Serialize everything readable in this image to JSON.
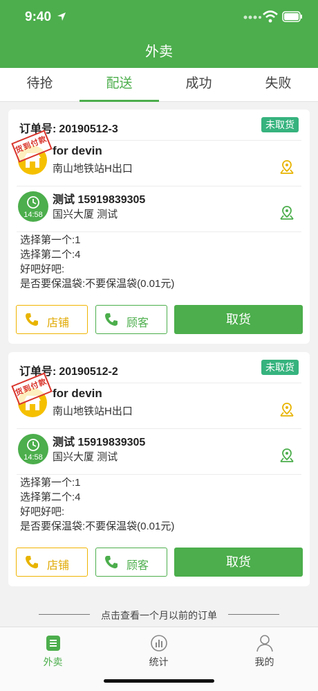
{
  "status_bar": {
    "time": "9:40"
  },
  "header": {
    "title": "外卖"
  },
  "tabs": [
    {
      "label": "待抢",
      "active": false
    },
    {
      "label": "配送",
      "active": true
    },
    {
      "label": "成功",
      "active": false
    },
    {
      "label": "失败",
      "active": false
    }
  ],
  "orders": [
    {
      "order_label": "订单号:",
      "order_no": "20190512-3",
      "status": "未取货",
      "stamp": "货到付款",
      "shop_name": "for devin",
      "shop_address": "南山地铁站H出口",
      "customer_time": "14:58",
      "customer_line": "测试 15919839305",
      "customer_address": "国兴大厦 测试",
      "options": [
        "选择第一个:1",
        "选择第二个:4",
        "好吧好吧:",
        "是否要保温袋:不要保温袋(0.01元)"
      ],
      "btn_store": "店铺",
      "btn_customer": "顾客",
      "btn_pickup": "取货"
    },
    {
      "order_label": "订单号:",
      "order_no": "20190512-2",
      "status": "未取货",
      "stamp": "货到付款",
      "shop_name": "for devin",
      "shop_address": "南山地铁站H出口",
      "customer_time": "14:58",
      "customer_line": "测试 15919839305",
      "customer_address": "国兴大厦 测试",
      "options": [
        "选择第一个:1",
        "选择第二个:4",
        "好吧好吧:",
        "是否要保温袋:不要保温袋(0.01元)"
      ],
      "btn_store": "店铺",
      "btn_customer": "顾客",
      "btn_pickup": "取货"
    }
  ],
  "history_link": "点击查看一个月以前的订单",
  "bottom_nav": [
    {
      "label": "外卖",
      "icon": "takeout-icon",
      "active": true
    },
    {
      "label": "统计",
      "icon": "stats-icon",
      "active": false
    },
    {
      "label": "我的",
      "icon": "profile-icon",
      "active": false
    }
  ],
  "colors": {
    "primary": "#4cae4c",
    "store_accent": "#f0b400",
    "badge": "#36b37e",
    "stamp": "#d9342b"
  }
}
